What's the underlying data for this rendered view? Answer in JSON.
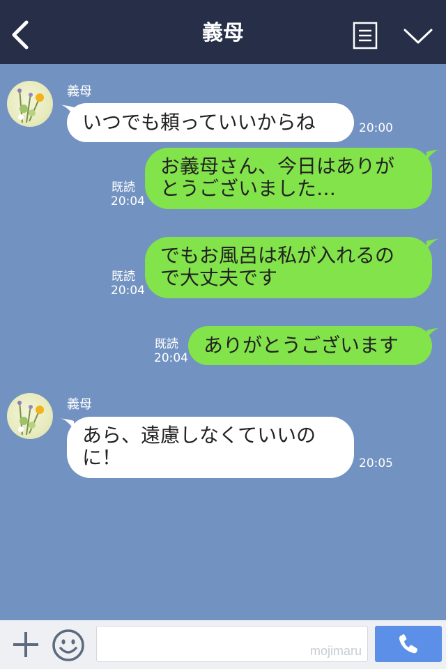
{
  "header": {
    "title": "義母",
    "icons": [
      "back-icon",
      "memo-icon",
      "chevron-down-icon"
    ]
  },
  "messages": [
    {
      "direction": "in",
      "sender": "義母",
      "lines": [
        "いつでも頼っていいからね"
      ],
      "time": "20:00"
    },
    {
      "direction": "out",
      "lines": [
        "お義母さん、今日はありが",
        "とうございました…"
      ],
      "read": "既読",
      "time": "20:04"
    },
    {
      "direction": "out",
      "lines": [
        "でもお風呂は私が入れるの",
        "で大丈夫です"
      ],
      "read": "既読",
      "time": "20:04"
    },
    {
      "direction": "out",
      "lines": [
        "ありがとうございます"
      ],
      "read": "既読",
      "time": "20:04"
    },
    {
      "direction": "in",
      "sender": "義母",
      "lines": [
        "あら、遠慮しなくていいの",
        "に！"
      ],
      "time": "20:05"
    }
  ],
  "footer": {
    "input_value": "",
    "watermark": "mojimaru",
    "icons": [
      "plus-icon",
      "emoji-icon",
      "phone-icon"
    ]
  },
  "colors": {
    "header_bg": "#262f47",
    "chat_bg": "#7292c1",
    "outgoing_bubble": "#82e34a",
    "incoming_bubble": "#ffffff",
    "call_button": "#5b8fe8"
  }
}
